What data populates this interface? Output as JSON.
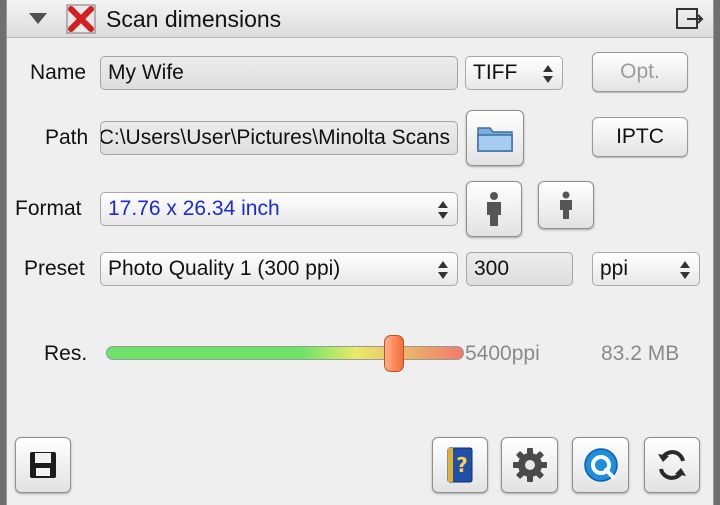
{
  "panel": {
    "title": "Scan dimensions",
    "icons": {
      "collapse": "collapse-arrow-icon",
      "app": "red-x-icon",
      "undock": "undock-icon"
    }
  },
  "fields": {
    "name": {
      "label": "Name",
      "value": "My Wife"
    },
    "file_type": {
      "value": "TIFF"
    },
    "opt_button": "Opt.",
    "path": {
      "label": "Path",
      "value": "C:\\Users\\User\\Pictures\\Minolta Scans"
    },
    "iptc_button": "IPTC",
    "format": {
      "label": "Format",
      "value": "17.76 x 26.34 inch"
    },
    "preset": {
      "label": "Preset",
      "value": "Photo Quality 1 (300 ppi)"
    },
    "ppi_value": "300",
    "ppi_unit": "ppi"
  },
  "resolution": {
    "label": "Res.",
    "value_text": "5400ppi",
    "size_text": "83.2 MB",
    "slider_fraction": 0.805,
    "track_colors": [
      "#6ee36a",
      "#e8ea6a",
      "#f07a6a"
    ]
  },
  "toolbar": {
    "icons": [
      "save-icon",
      "help-book-icon",
      "gear-icon",
      "quick-scan-icon",
      "refresh-icon"
    ]
  },
  "colors": {
    "format_text": "#1a2ad8",
    "slider_thumb": "#ff8a5a"
  }
}
